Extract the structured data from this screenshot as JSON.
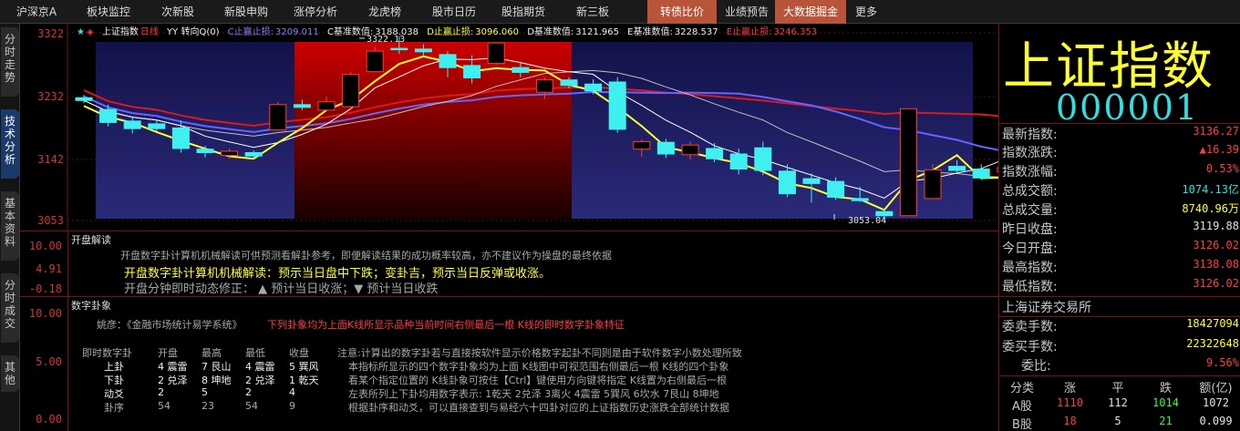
{
  "menu": [
    "沪深京A",
    "板块监控",
    "次新股",
    "新股申购",
    "涨停分析",
    "龙虎榜",
    "股市日历",
    "股指期货",
    "新三板",
    "转债比价",
    "业绩预告",
    "大数据掘金",
    "更多"
  ],
  "side_tabs": [
    "分时走势",
    "技术分析",
    "基本资料",
    "分时成交",
    "其他"
  ],
  "chart": {
    "y_labels": [
      "3322",
      "3232",
      "3142",
      "3053"
    ],
    "info": {
      "name": "上证指数",
      "period": "日线",
      "mode": "YY 转向Q(0)",
      "c_label": "C止赢止损:",
      "c_val": "3209.011",
      "cb_label": "C基准数值:",
      "cb_val": "3188.038",
      "d_label": "D止赢止损:",
      "d_val": "3096.060",
      "db_label": "D基准数值:",
      "db_val": "3121.965",
      "eb_label": "E基准数值:",
      "eb_val": "3228.537",
      "e_label": "E止赢止损:",
      "e_val": "3246.353"
    },
    "high_label": "3322.13",
    "low_label": "3053.04"
  },
  "chart_data": {
    "type": "candlestick",
    "ylim": [
      3053,
      3340
    ],
    "candles": [
      {
        "o": 3232,
        "h": 3236,
        "c": 3228,
        "l": 3224
      },
      {
        "o": 3215,
        "h": 3222,
        "c": 3196,
        "l": 3190
      },
      {
        "o": 3198,
        "h": 3205,
        "c": 3187,
        "l": 3180
      },
      {
        "o": 3194,
        "h": 3200,
        "c": 3187,
        "l": 3183
      },
      {
        "o": 3188,
        "h": 3199,
        "c": 3158,
        "l": 3152
      },
      {
        "o": 3157,
        "h": 3162,
        "c": 3152,
        "l": 3145
      },
      {
        "o": 3148,
        "h": 3158,
        "c": 3154,
        "l": 3143
      },
      {
        "o": 3152,
        "h": 3155,
        "c": 3147,
        "l": 3142
      },
      {
        "o": 3185,
        "h": 3226,
        "c": 3222,
        "l": 3185
      },
      {
        "o": 3222,
        "h": 3229,
        "c": 3218,
        "l": 3214
      },
      {
        "o": 3214,
        "h": 3234,
        "c": 3226,
        "l": 3214
      },
      {
        "o": 3219,
        "h": 3270,
        "c": 3266,
        "l": 3214
      },
      {
        "o": 3270,
        "h": 3306,
        "c": 3300,
        "l": 3270
      },
      {
        "o": 3304,
        "h": 3322,
        "c": 3302,
        "l": 3296
      },
      {
        "o": 3303,
        "h": 3310,
        "c": 3299,
        "l": 3292
      },
      {
        "o": 3295,
        "h": 3300,
        "c": 3276,
        "l": 3262
      },
      {
        "o": 3279,
        "h": 3294,
        "c": 3261,
        "l": 3253
      },
      {
        "o": 3282,
        "h": 3300,
        "c": 3312,
        "l": 3280
      },
      {
        "o": 3276,
        "h": 3284,
        "c": 3269,
        "l": 3262
      },
      {
        "o": 3240,
        "h": 3262,
        "c": 3258,
        "l": 3230
      },
      {
        "o": 3258,
        "h": 3262,
        "c": 3250,
        "l": 3246
      },
      {
        "o": 3252,
        "h": 3259,
        "c": 3242,
        "l": 3237
      },
      {
        "o": 3255,
        "h": 3262,
        "c": 3186,
        "l": 3181
      },
      {
        "o": 3157,
        "h": 3171,
        "c": 3168,
        "l": 3146
      },
      {
        "o": 3167,
        "h": 3172,
        "c": 3150,
        "l": 3144
      },
      {
        "o": 3149,
        "h": 3168,
        "c": 3163,
        "l": 3142
      },
      {
        "o": 3158,
        "h": 3166,
        "c": 3143,
        "l": 3138
      },
      {
        "o": 3150,
        "h": 3158,
        "c": 3128,
        "l": 3120
      },
      {
        "o": 3159,
        "h": 3168,
        "c": 3126,
        "l": 3119
      },
      {
        "o": 3125,
        "h": 3135,
        "c": 3092,
        "l": 3087
      },
      {
        "o": 3114,
        "h": 3122,
        "c": 3107,
        "l": 3079
      },
      {
        "o": 3110,
        "h": 3116,
        "c": 3087,
        "l": 3083
      },
      {
        "o": 3085,
        "h": 3102,
        "c": 3082,
        "l": 3080
      },
      {
        "o": 3066,
        "h": 3070,
        "c": 3060,
        "l": 3053
      },
      {
        "o": 3060,
        "h": 3216,
        "c": 3216,
        "l": 3060
      },
      {
        "o": 3085,
        "h": 3135,
        "c": 3127,
        "l": 3085
      },
      {
        "o": 3132,
        "h": 3141,
        "c": 3126,
        "l": 3122
      },
      {
        "o": 3128,
        "h": 3135,
        "c": 3115,
        "l": 3112
      },
      {
        "o": 3124,
        "h": 3133,
        "c": 3130,
        "l": 3121
      }
    ]
  },
  "panel1": {
    "title": "开盘解读",
    "y_labels": [
      "10.00",
      "4.91",
      "-0.18"
    ],
    "line1": "开盘数字卦计算机机械解读可供预测看解卦参考，即便解读结果的成功概率较高，亦不建议作为操盘的最终依据",
    "line2": "开盘数字卦计算机机械解读：预示当日盘中下跌；变卦吉，预示当日反弹或收涨。",
    "line3": "开盘分钟即时动态修正：  ▲ 预计当日收涨；▼ 预计当日收跌"
  },
  "panel2": {
    "title": "数字卦象",
    "y_labels": [
      "10.00",
      "5.00",
      "0.00"
    ],
    "source_prefix": "姚彦：《金融市场统计易学系统》",
    "source_red": "下列卦象均为上面K线所显示品种当前时间右侧最后一根  K线的即时数字卦象特征",
    "table_header": [
      "即时数字卦",
      "开盘",
      "最高",
      "最低",
      "收盘"
    ],
    "table_rows": [
      [
        "上卦",
        "4 震雷",
        "7 艮山",
        "4 震雷",
        "5 巽风"
      ],
      [
        "下卦",
        "2 兑泽",
        "8 坤地",
        "2 兑泽",
        "1 乾天"
      ],
      [
        "动爻",
        "2",
        "5",
        "2",
        "4"
      ],
      [
        "卦序",
        "54",
        "23",
        "54",
        "9"
      ]
    ],
    "note": [
      "注意:计算出的数字卦若与直接按软件显示价格数字起卦不同则是由于软件数字小数处理所致",
      "本指标所显示的四个数字卦象均为上面 K线图中可视范围右侧最后一根 K线的四个卦象",
      "看某个指定位置的 K线卦象可按住【Ctrl】键使用方向键将指定 K线置为右侧最后一根",
      "左表所列上下卦均用数字表示: 1乾天 2兑泽 3离火 4震雷 5巽风 6坎水 7艮山 8坤地",
      "根据卦序和动爻，可以直接查到与易经六十四卦对应的上证指数历史涨跌全部统计数据"
    ]
  },
  "right": {
    "name": "上证指数",
    "code": "000001",
    "rows1": [
      {
        "label": "最新指数:",
        "value": "3136.27",
        "color": "#ff3c3c"
      },
      {
        "label": "指数涨跌:",
        "value": "▲16.39",
        "color": "#ff3c3c"
      },
      {
        "label": "指数涨幅:",
        "value": "0.53%",
        "color": "#ff3c3c"
      },
      {
        "label": "总成交额:",
        "value": "1074.13亿",
        "color": "#30e0e0"
      },
      {
        "label": "总成交量:",
        "value": "8740.96万",
        "color": "#ffff30"
      },
      {
        "label": "昨日收盘:",
        "value": "3119.88",
        "color": "#e0e0e0"
      },
      {
        "label": "今日开盘:",
        "value": "3126.02",
        "color": "#ff3c3c"
      },
      {
        "label": "最高指数:",
        "value": "3138.08",
        "color": "#ff3c3c"
      },
      {
        "label": "最低指数:",
        "value": "3126.02",
        "color": "#ff3c3c"
      }
    ],
    "exchange": "上海证券交易所",
    "rows2": [
      {
        "label": "委卖手数:",
        "value": "18427094",
        "color": "#ffff30"
      },
      {
        "label": "委买手数:",
        "value": "22322648",
        "color": "#ffff30"
      },
      {
        "label": "委比:",
        "value": "9.56%",
        "color": "#ff3c3c"
      }
    ],
    "table_header": [
      "分类",
      "涨",
      "平",
      "跌",
      "额(亿)"
    ],
    "table_rows": [
      [
        "A股",
        "1110",
        "112",
        "1014",
        "1072"
      ],
      [
        "B股",
        "18",
        "5",
        "21",
        "0.099"
      ]
    ]
  }
}
